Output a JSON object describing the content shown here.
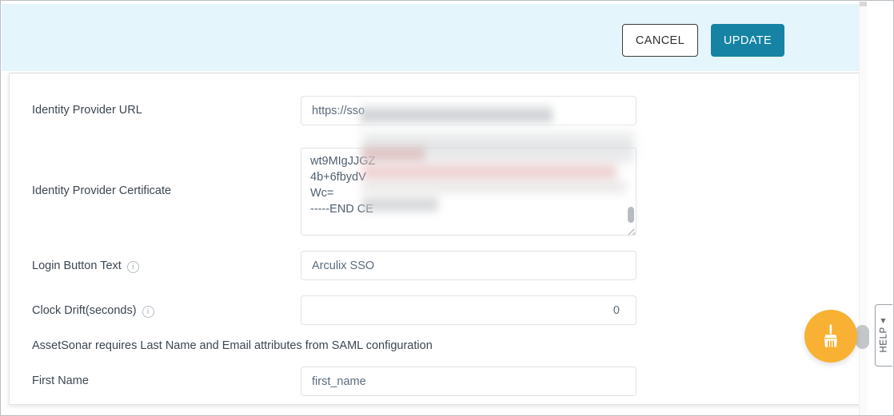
{
  "theme": {
    "header_bg": "#e4f5fb",
    "primary_button_bg": "#1683a4",
    "fab_bg": "#f8b133",
    "label_color": "#3c4650",
    "input_text_color": "#5b6b7b",
    "card_bg": "#ffffff"
  },
  "action_bar": {
    "cancel_label": "CANCEL",
    "update_label": "UPDATE"
  },
  "form": {
    "fields": [
      {
        "id": "identity-provider-url",
        "label": "Identity Provider URL",
        "value": "https://sso",
        "has_info_icon": false,
        "type": "text"
      },
      {
        "id": "identity-provider-certificate",
        "label": "Identity Provider Certificate",
        "value": "wt9MIgJJGZ\n4b+6fbydV\nWc=\n-----END CE",
        "has_info_icon": false,
        "type": "textarea"
      },
      {
        "id": "login-button-text",
        "label": "Login Button Text",
        "value": "Arculix SSO",
        "has_info_icon": true,
        "type": "text"
      },
      {
        "id": "clock-drift-seconds",
        "label": "Clock Drift(seconds)",
        "value": "0",
        "has_info_icon": true,
        "type": "number"
      },
      {
        "id": "first-name",
        "label": "First Name",
        "value": "first_name",
        "has_info_icon": false,
        "type": "text"
      }
    ],
    "saml_note": "AssetSonar requires Last Name and Email attributes from SAML configuration"
  },
  "help_tab": {
    "label": "HELP",
    "caret": "◀"
  },
  "fab": {
    "icon_name": "broom-icon"
  }
}
